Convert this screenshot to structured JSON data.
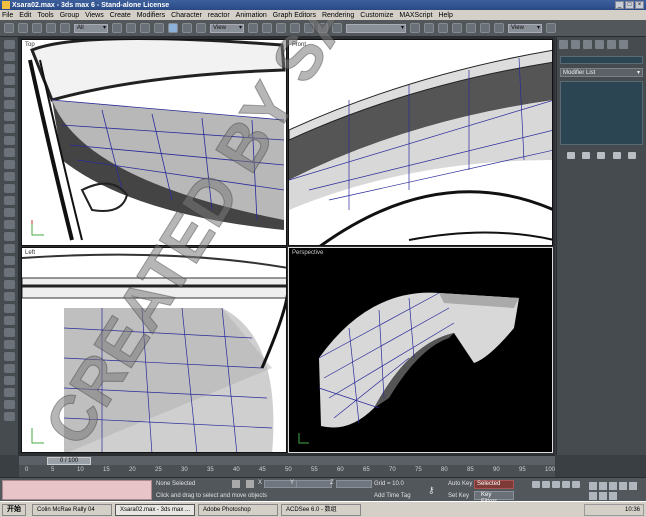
{
  "window": {
    "title": "Xsara02.max - 3ds max 6 - Stand-alone License"
  },
  "menu": [
    "File",
    "Edit",
    "Tools",
    "Group",
    "Views",
    "Create",
    "Modifiers",
    "Character",
    "reactor",
    "Animation",
    "Graph Editors",
    "Rendering",
    "Customize",
    "MAXScript",
    "Help"
  ],
  "toolbar": {
    "selection_filter": "All",
    "ref_coord": "View",
    "named_sel": "",
    "render_view": "View"
  },
  "viewports": [
    {
      "id": "top",
      "label": "Top"
    },
    {
      "id": "front",
      "label": "Front"
    },
    {
      "id": "left",
      "label": "Left"
    },
    {
      "id": "perspective",
      "label": "Perspective"
    }
  ],
  "command_panel": {
    "modifier_list": "Modifier List",
    "object_name": ""
  },
  "time": {
    "slider_label": "0 / 100",
    "ticks": [
      "0",
      "5",
      "10",
      "15",
      "20",
      "25",
      "30",
      "35",
      "40",
      "45",
      "50",
      "55",
      "60",
      "65",
      "70",
      "75",
      "80",
      "85",
      "90",
      "95",
      "100"
    ]
  },
  "status": {
    "selection": "None Selected",
    "prompt": "Click and drag to select and move objects",
    "x_label": "X",
    "y_label": "Y",
    "z_label": "Z",
    "grid": "Grid = 10.0",
    "time_tag": "Add Time Tag",
    "auto_key": "Auto Key",
    "set_key": "Set Key",
    "selected": "Selected",
    "key_filters": "Key Filters..."
  },
  "taskbar": {
    "start": "开始",
    "tasks": [
      "Colin McRae Rally 04",
      "Xsara02.max - 3ds max ...",
      "Adobe Photoshop",
      "ACDSee 6.0 - 数组"
    ],
    "clock": "10:36"
  },
  "watermark": "CREATED BY SANSHI",
  "colors": {
    "accent": "#2a4a86",
    "viewport_active_bg": "#000000",
    "wire": "#2a2a9a"
  }
}
